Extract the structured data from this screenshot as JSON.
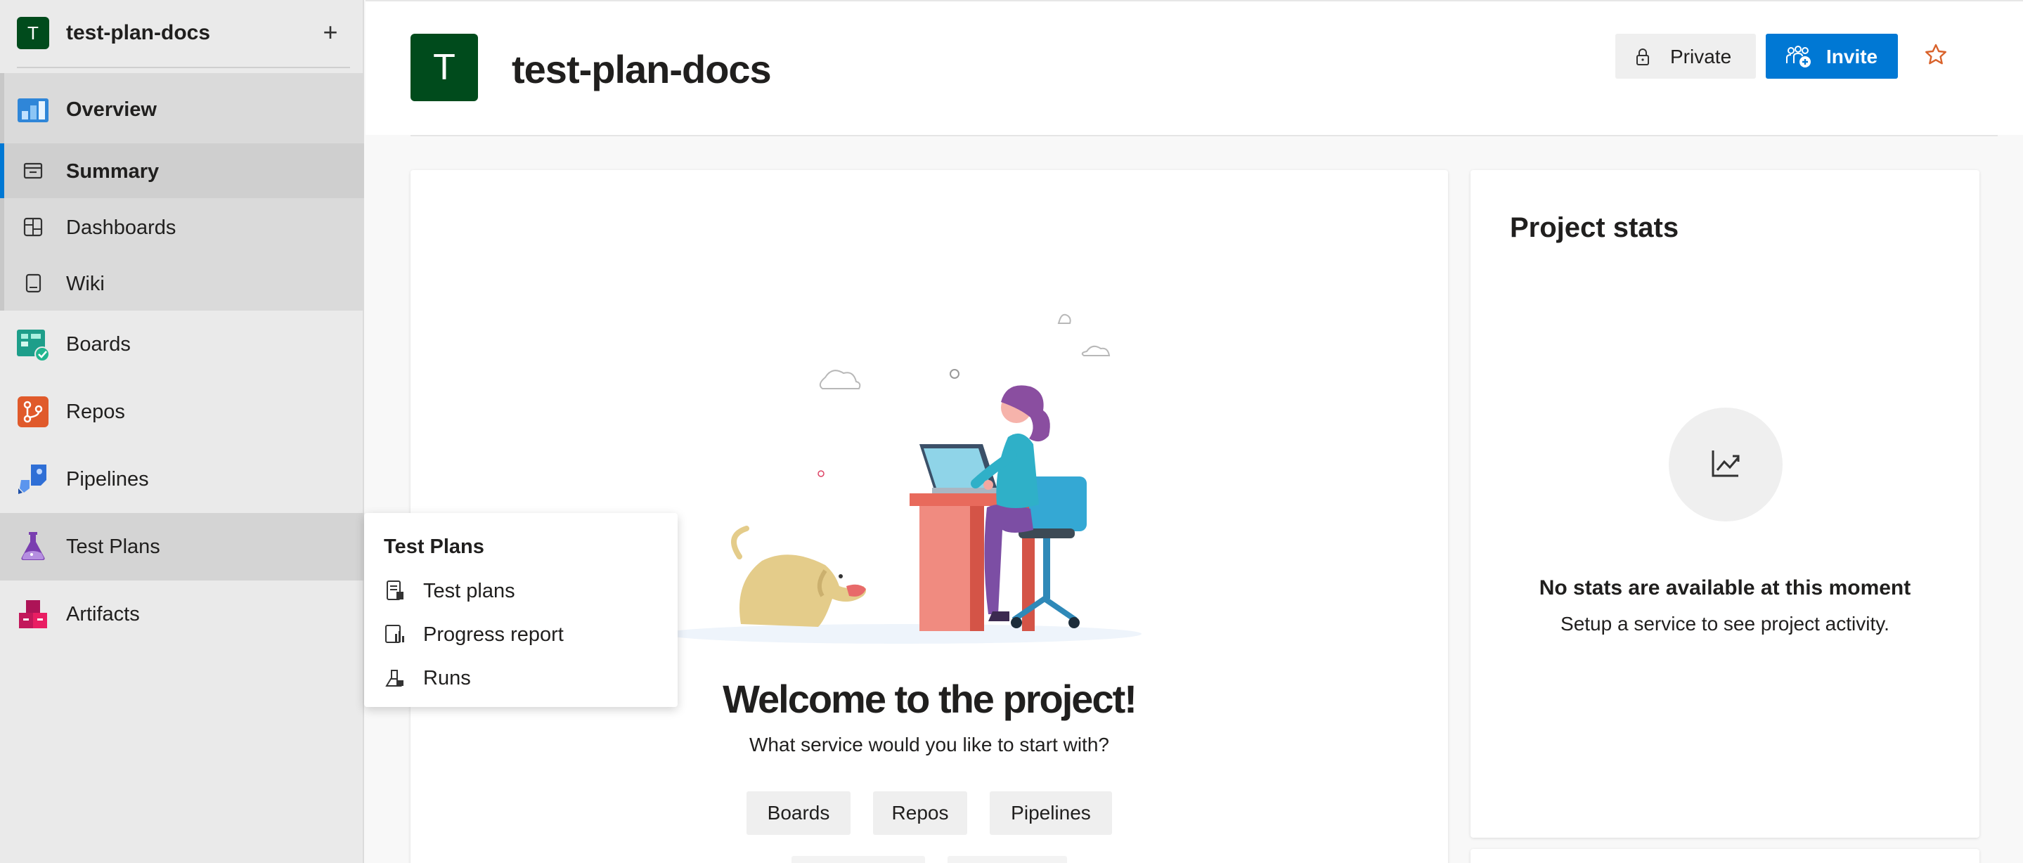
{
  "project": {
    "name": "test-plan-docs",
    "initial": "T",
    "avatar_color": "#004b1c"
  },
  "sidebar": {
    "add_icon": "plus-icon",
    "items": [
      {
        "label": "Overview",
        "icon": "overview-icon"
      },
      {
        "label": "Summary",
        "icon": "summary-icon",
        "active": true
      },
      {
        "label": "Dashboards",
        "icon": "dashboards-icon"
      },
      {
        "label": "Wiki",
        "icon": "wiki-icon"
      },
      {
        "label": "Boards",
        "icon": "boards-icon"
      },
      {
        "label": "Repos",
        "icon": "repos-icon"
      },
      {
        "label": "Pipelines",
        "icon": "pipelines-icon"
      },
      {
        "label": "Test Plans",
        "icon": "test-plans-icon",
        "hovered": true
      },
      {
        "label": "Artifacts",
        "icon": "artifacts-icon"
      }
    ]
  },
  "header": {
    "title": "test-plan-docs",
    "private_label": "Private",
    "invite_label": "Invite",
    "accent_color": "#0078d4",
    "star_icon": "star-icon"
  },
  "flyout": {
    "title": "Test Plans",
    "items": [
      {
        "label": "Test plans",
        "icon": "test-plans-list-icon"
      },
      {
        "label": "Progress report",
        "icon": "progress-report-icon"
      },
      {
        "label": "Runs",
        "icon": "runs-icon"
      }
    ]
  },
  "welcome": {
    "title": "Welcome to the project!",
    "subtitle": "What service would you like to start with?",
    "services": [
      "Boards",
      "Repos",
      "Pipelines"
    ]
  },
  "stats": {
    "title": "Project stats",
    "empty_title": "No stats are available at this moment",
    "empty_subtitle": "Setup a service to see project activity.",
    "icon": "chart-line-icon"
  }
}
